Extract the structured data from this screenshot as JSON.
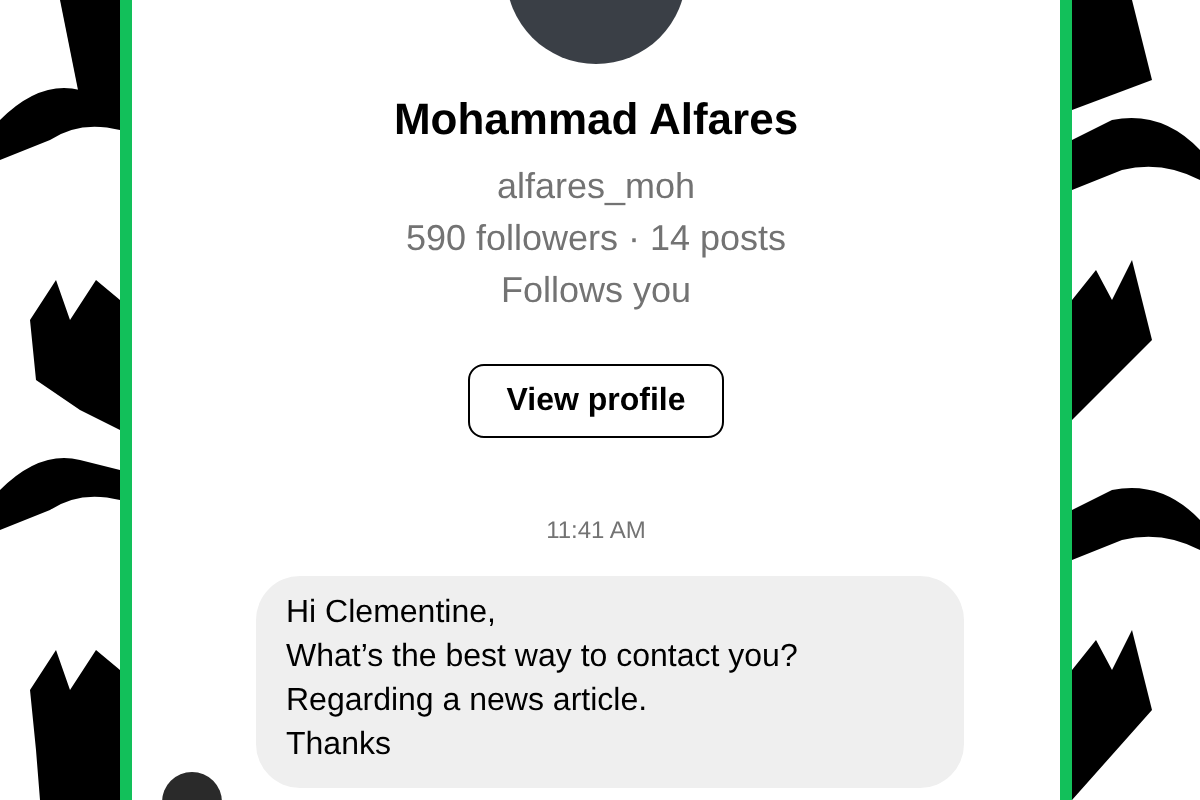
{
  "profile": {
    "name": "Mohammad Alfares",
    "username": "alfares_moh",
    "stats": "590 followers · 14 posts",
    "relation": "Follows you",
    "button": "View profile"
  },
  "messages": [
    {
      "time": "11:41 AM",
      "lines": [
        "Hi Clementine,",
        "What’s the best way to contact you?",
        "Regarding a news article.",
        "Thanks"
      ]
    }
  ]
}
